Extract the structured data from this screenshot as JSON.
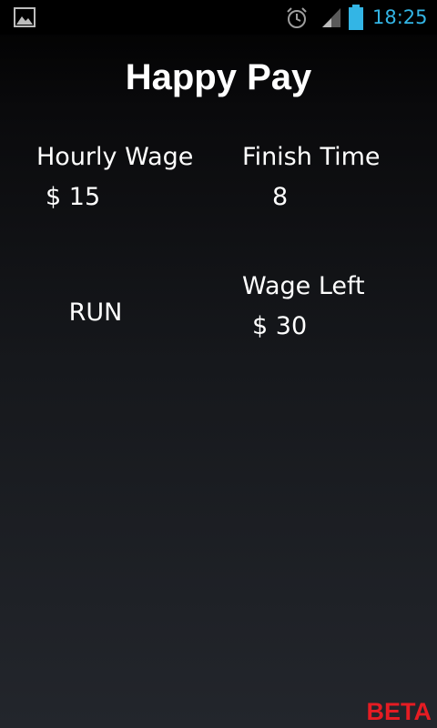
{
  "status_bar": {
    "time": "18:25",
    "icons": [
      "gallery-icon",
      "alarm-icon",
      "signal-icon",
      "battery-icon"
    ],
    "clock_color": "#33b5e5"
  },
  "app": {
    "title": "Happy Pay"
  },
  "hourly_wage": {
    "label": "Hourly Wage",
    "value": "$ 15"
  },
  "finish_time": {
    "label": "Finish Time",
    "value": "8"
  },
  "run_button": {
    "label": "RUN"
  },
  "wage_left": {
    "label": "Wage Left",
    "value": "$ 30"
  },
  "footer": {
    "beta_label": "BETA",
    "beta_color": "#e51c23"
  }
}
